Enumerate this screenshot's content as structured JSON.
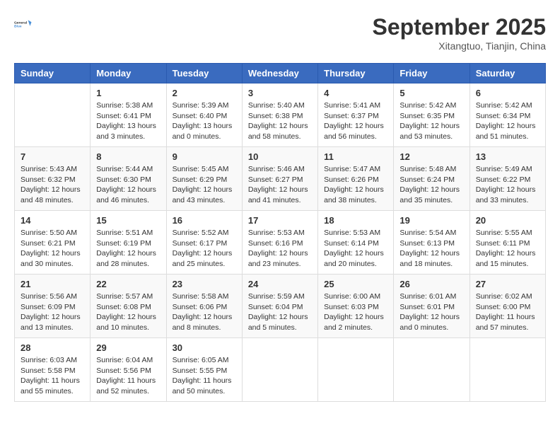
{
  "header": {
    "logo_line1": "General",
    "logo_line2": "Blue",
    "month_title": "September 2025",
    "subtitle": "Xitangtuo, Tianjin, China"
  },
  "days_of_week": [
    "Sunday",
    "Monday",
    "Tuesday",
    "Wednesday",
    "Thursday",
    "Friday",
    "Saturday"
  ],
  "weeks": [
    [
      {
        "day": "",
        "info": ""
      },
      {
        "day": "1",
        "info": "Sunrise: 5:38 AM\nSunset: 6:41 PM\nDaylight: 13 hours\nand 3 minutes."
      },
      {
        "day": "2",
        "info": "Sunrise: 5:39 AM\nSunset: 6:40 PM\nDaylight: 13 hours\nand 0 minutes."
      },
      {
        "day": "3",
        "info": "Sunrise: 5:40 AM\nSunset: 6:38 PM\nDaylight: 12 hours\nand 58 minutes."
      },
      {
        "day": "4",
        "info": "Sunrise: 5:41 AM\nSunset: 6:37 PM\nDaylight: 12 hours\nand 56 minutes."
      },
      {
        "day": "5",
        "info": "Sunrise: 5:42 AM\nSunset: 6:35 PM\nDaylight: 12 hours\nand 53 minutes."
      },
      {
        "day": "6",
        "info": "Sunrise: 5:42 AM\nSunset: 6:34 PM\nDaylight: 12 hours\nand 51 minutes."
      }
    ],
    [
      {
        "day": "7",
        "info": "Sunrise: 5:43 AM\nSunset: 6:32 PM\nDaylight: 12 hours\nand 48 minutes."
      },
      {
        "day": "8",
        "info": "Sunrise: 5:44 AM\nSunset: 6:30 PM\nDaylight: 12 hours\nand 46 minutes."
      },
      {
        "day": "9",
        "info": "Sunrise: 5:45 AM\nSunset: 6:29 PM\nDaylight: 12 hours\nand 43 minutes."
      },
      {
        "day": "10",
        "info": "Sunrise: 5:46 AM\nSunset: 6:27 PM\nDaylight: 12 hours\nand 41 minutes."
      },
      {
        "day": "11",
        "info": "Sunrise: 5:47 AM\nSunset: 6:26 PM\nDaylight: 12 hours\nand 38 minutes."
      },
      {
        "day": "12",
        "info": "Sunrise: 5:48 AM\nSunset: 6:24 PM\nDaylight: 12 hours\nand 35 minutes."
      },
      {
        "day": "13",
        "info": "Sunrise: 5:49 AM\nSunset: 6:22 PM\nDaylight: 12 hours\nand 33 minutes."
      }
    ],
    [
      {
        "day": "14",
        "info": "Sunrise: 5:50 AM\nSunset: 6:21 PM\nDaylight: 12 hours\nand 30 minutes."
      },
      {
        "day": "15",
        "info": "Sunrise: 5:51 AM\nSunset: 6:19 PM\nDaylight: 12 hours\nand 28 minutes."
      },
      {
        "day": "16",
        "info": "Sunrise: 5:52 AM\nSunset: 6:17 PM\nDaylight: 12 hours\nand 25 minutes."
      },
      {
        "day": "17",
        "info": "Sunrise: 5:53 AM\nSunset: 6:16 PM\nDaylight: 12 hours\nand 23 minutes."
      },
      {
        "day": "18",
        "info": "Sunrise: 5:53 AM\nSunset: 6:14 PM\nDaylight: 12 hours\nand 20 minutes."
      },
      {
        "day": "19",
        "info": "Sunrise: 5:54 AM\nSunset: 6:13 PM\nDaylight: 12 hours\nand 18 minutes."
      },
      {
        "day": "20",
        "info": "Sunrise: 5:55 AM\nSunset: 6:11 PM\nDaylight: 12 hours\nand 15 minutes."
      }
    ],
    [
      {
        "day": "21",
        "info": "Sunrise: 5:56 AM\nSunset: 6:09 PM\nDaylight: 12 hours\nand 13 minutes."
      },
      {
        "day": "22",
        "info": "Sunrise: 5:57 AM\nSunset: 6:08 PM\nDaylight: 12 hours\nand 10 minutes."
      },
      {
        "day": "23",
        "info": "Sunrise: 5:58 AM\nSunset: 6:06 PM\nDaylight: 12 hours\nand 8 minutes."
      },
      {
        "day": "24",
        "info": "Sunrise: 5:59 AM\nSunset: 6:04 PM\nDaylight: 12 hours\nand 5 minutes."
      },
      {
        "day": "25",
        "info": "Sunrise: 6:00 AM\nSunset: 6:03 PM\nDaylight: 12 hours\nand 2 minutes."
      },
      {
        "day": "26",
        "info": "Sunrise: 6:01 AM\nSunset: 6:01 PM\nDaylight: 12 hours\nand 0 minutes."
      },
      {
        "day": "27",
        "info": "Sunrise: 6:02 AM\nSunset: 6:00 PM\nDaylight: 11 hours\nand 57 minutes."
      }
    ],
    [
      {
        "day": "28",
        "info": "Sunrise: 6:03 AM\nSunset: 5:58 PM\nDaylight: 11 hours\nand 55 minutes."
      },
      {
        "day": "29",
        "info": "Sunrise: 6:04 AM\nSunset: 5:56 PM\nDaylight: 11 hours\nand 52 minutes."
      },
      {
        "day": "30",
        "info": "Sunrise: 6:05 AM\nSunset: 5:55 PM\nDaylight: 11 hours\nand 50 minutes."
      },
      {
        "day": "",
        "info": ""
      },
      {
        "day": "",
        "info": ""
      },
      {
        "day": "",
        "info": ""
      },
      {
        "day": "",
        "info": ""
      }
    ]
  ]
}
